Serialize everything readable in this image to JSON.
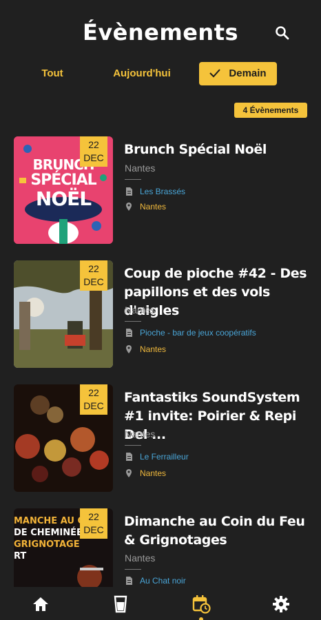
{
  "header": {
    "title": "Évènements"
  },
  "filters": {
    "all": "Tout",
    "today": "Aujourd'hui",
    "tomorrow": "Demain"
  },
  "count": "4 Évènements",
  "events": [
    {
      "day": "22",
      "month": "DEC",
      "title": "Brunch Spécial Noël",
      "city": "Nantes",
      "venue": "Les Brassés",
      "venue_city": "Nantes",
      "image_text": [
        "BRUNCH",
        "SPÉCIAL",
        "NOËL"
      ]
    },
    {
      "day": "22",
      "month": "DEC",
      "title": "Coup de pioche #42 - Des papillons et des vols d'aigles",
      "city": "Nantes",
      "venue": "Pioche - bar de jeux coopératifs",
      "venue_city": "Nantes"
    },
    {
      "day": "22",
      "month": "DEC",
      "title": "Fantastiks SoundSystem #1 invite: Poirier & Repi Del ...",
      "city": "Nantes",
      "venue": "Le Ferrailleur",
      "venue_city": "Nantes"
    },
    {
      "day": "22",
      "month": "DEC",
      "title": "Dimanche au Coin du Feu & Grignotages",
      "city": "Nantes",
      "venue": "Au Chat noir",
      "image_text": [
        "MANCHE AU C",
        "DE CHEMINÉE",
        "GRIGNOTAGE",
        "RT"
      ]
    }
  ],
  "colors": {
    "accent": "#f5c33b",
    "background": "#202020",
    "venue_link": "#4aa6d8"
  },
  "nav": [
    "home-icon",
    "drink-icon",
    "calendar-icon",
    "gear-icon"
  ]
}
